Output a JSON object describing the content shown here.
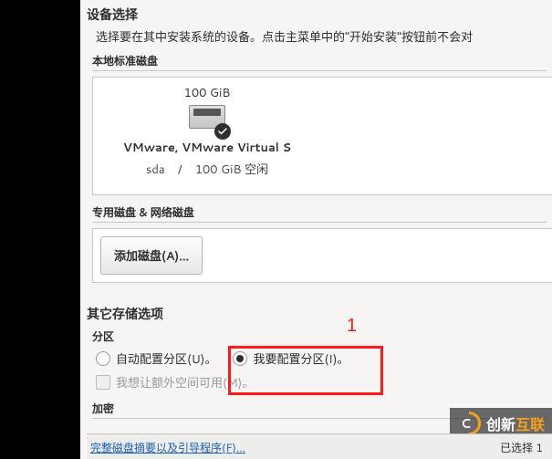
{
  "device_selection": {
    "title": "设备选择",
    "instruction": "选择要在其中安装系统的设备。点击主菜单中的\"开始安装\"按钮前不会对"
  },
  "local_disks": {
    "header": "本地标准磁盘",
    "disk": {
      "size": "100 GiB",
      "name": "VMware, VMware Virtual S",
      "dev": "sda",
      "sep": "/",
      "free": "100 GiB 空闲"
    }
  },
  "special_disks": {
    "header": "专用磁盘 & 网络磁盘",
    "add_button": "添加磁盘(A)..."
  },
  "other_storage": {
    "title": "其它存储选项",
    "partition_header": "分区",
    "auto_label": "自动配置分区(U)。",
    "manual_label": "我要配置分区(I)。",
    "extra_space_label": "我想让额外空间可用(M)。",
    "encrypt_header": "加密"
  },
  "annotation": {
    "one": "1"
  },
  "footer": {
    "link": "完整磁盘摘要以及引导程序(F)...",
    "status": "已选择 1"
  },
  "watermark": {
    "white": "创新",
    "orange": "互联"
  }
}
